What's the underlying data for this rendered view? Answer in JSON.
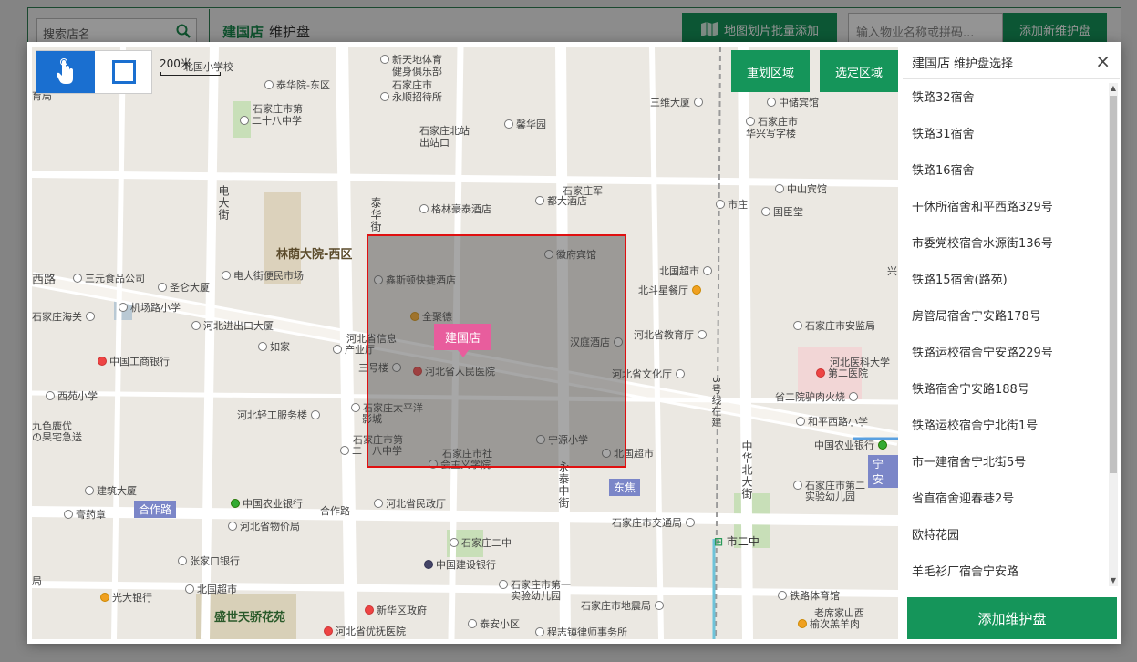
{
  "background": {
    "search_placeholder": "搜索店名",
    "store_name": "建国店",
    "page_subtitle": "维护盘",
    "batch_add_label": "地图划片批量添加",
    "property_placeholder": "输入物业名称或拼码...",
    "add_new_label": "添加新维护盘"
  },
  "map": {
    "scale_label": "200米",
    "redraw_label": "重划区域",
    "select_label": "选定区域",
    "store_pin": "建国店",
    "labels": {
      "l1": "新天地体育",
      "l1b": "健身俱乐部",
      "l2": "石家庄市",
      "l2b": "永顺招待所",
      "l3": "泰华院-东区",
      "l4": "石家庄市第",
      "l4b": "二十八中学",
      "l5": "石家庄北站",
      "l5b": "出站口",
      "l6": "馨华园",
      "l7": "三维大厦",
      "l8": "中储宾馆",
      "l9": "石家庄市",
      "l9b": "华兴写字楼",
      "l10": "石家庄军",
      "l10b": "都大酒店",
      "l11": "格林豪泰酒店",
      "l12": "中山宾馆",
      "l13": "市庄",
      "l14": "国臣堂",
      "l15": "林荫大院-西区",
      "l16": "徽府宾馆",
      "l17": "三元食品公司",
      "l18": "圣仑大厦",
      "l19": "电大街便民市场",
      "l20": "鑫斯顿快捷酒店",
      "l21": "北国超市",
      "l22": "北斗星餐厅",
      "l23": "机场路小学",
      "l24": "石家庄海关",
      "l25": "河北进出口大厦",
      "l26": "全聚德",
      "l27": "河北省信息",
      "l27b": "产业厅",
      "l28": "汉庭酒店",
      "l29": "河北省教育厅",
      "l30": "石家庄市安监局",
      "l31": "如家",
      "l32": "中国工商银行",
      "l33": "三号楼",
      "l34": "河北省人民医院",
      "l35": "河北省文化厅",
      "l36": "河北医科大学",
      "l36b": "第二医院",
      "l37": "西苑小学",
      "l38": "省二院驴肉火烧",
      "l39": "石家庄太平洋",
      "l39b": "影城",
      "l40": "河北轻工服务楼",
      "l41": "和平西路小学",
      "l42": "九色鹿优",
      "l42b": "の果宅急送",
      "l43": "石家庄市第",
      "l43b": "二十八中学",
      "l44": "宁源小学",
      "l45": "石家庄市社",
      "l45b": "会主义学院",
      "l46": "北国超市",
      "l47": "中国农业银行",
      "l48": "建筑大厦",
      "l49": "石家庄市第二",
      "l49b": "实验幼儿园",
      "l50": "中国农业银行",
      "l51": "合作路",
      "l52": "河北省民政厅",
      "l53": "膏药章",
      "l54": "河北省物价局",
      "l55": "石家庄市交通局",
      "l56": "石家庄二中",
      "l57": "张家口银行",
      "l58": "中国建设银行",
      "l59": "北国超市",
      "l60": "石家庄市第一",
      "l60b": "实验幼儿园",
      "l61": "光大银行",
      "l62": "石家庄市地震局",
      "l63": "铁路体育馆",
      "l64": "盛世天骄花苑",
      "l65": "新华区政府",
      "l66": "泰安小区",
      "l67": "老席家山西",
      "l67b": "榆次羔羊肉",
      "l68": "河北省优抚医院",
      "l69": "程志镇律师事务所",
      "l70": "西路",
      "l71": "电大街",
      "l72": "泰华街",
      "l73": "永泰中街",
      "l74": "中华北大街",
      "l75": "3号线在建",
      "l76": "中储",
      "l77": "兴",
      "l78": "局",
      "l79": "育局",
      "l80": "北国小学校",
      "l81": "市二中",
      "l82": "合作路",
      "l83": "东焦",
      "l84": "宁安"
    }
  },
  "panel": {
    "title": "建国店",
    "subtitle": "维护盘选择",
    "close": "×",
    "items": [
      "铁路32宿舍",
      "铁路31宿舍",
      "铁路16宿舍",
      "干休所宿舍和平西路329号",
      "市委党校宿舍水源街136号",
      "铁路15宿舍(路苑)",
      "房管局宿舍宁安路178号",
      "铁路运校宿舍宁安路229号",
      "铁路宿舍宁安路188号",
      "铁路运校宿舍宁北街1号",
      "市一建宿舍宁北街5号",
      "省直宿舍迎春巷2号",
      "欧特花园",
      "羊毛衫厂宿舍宁安路"
    ],
    "add_label": "添加维护盘"
  }
}
